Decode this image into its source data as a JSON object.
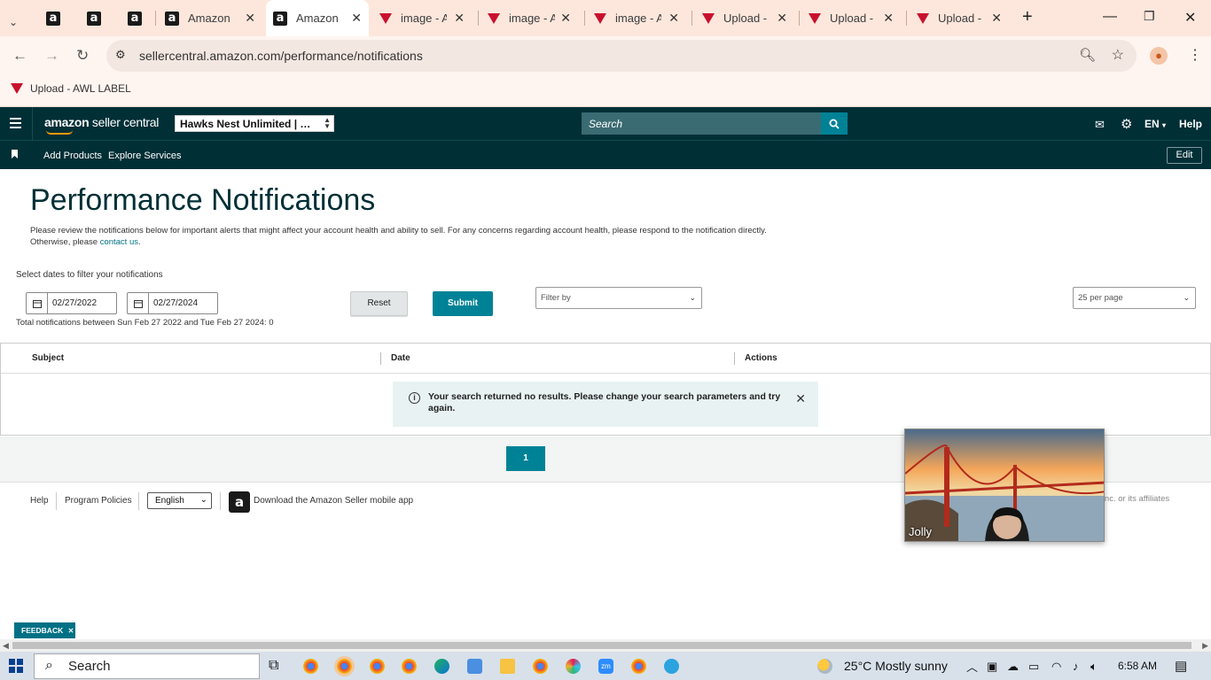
{
  "browser": {
    "tabs": [
      {
        "title": "",
        "icon": "amazon-favicon"
      },
      {
        "title": "",
        "icon": "amazon-favicon"
      },
      {
        "title": "",
        "icon": "amazon-favicon"
      },
      {
        "title": "Amazon",
        "icon": "amazon-favicon"
      },
      {
        "title": "Amazon",
        "icon": "amazon-favicon",
        "active": true
      },
      {
        "title": "image - A",
        "icon": "awl-favicon"
      },
      {
        "title": "image - A",
        "icon": "awl-favicon"
      },
      {
        "title": "image - A",
        "icon": "awl-favicon"
      },
      {
        "title": "Upload -",
        "icon": "awl-favicon"
      },
      {
        "title": "Upload -",
        "icon": "awl-favicon"
      },
      {
        "title": "Upload -",
        "icon": "awl-favicon"
      }
    ],
    "url": "sellercentral.amazon.com/performance/notifications",
    "bookmark": "Upload - AWL LABEL"
  },
  "header": {
    "logo_main": "amazon",
    "logo_sub": " seller central",
    "account": "Hawks Nest Unlimited | Unit...",
    "search_placeholder": "Search",
    "language": "EN",
    "help": "Help",
    "nav": [
      "Add Products",
      "Explore Services"
    ],
    "edit": "Edit"
  },
  "page": {
    "title": "Performance Notifications",
    "description": "Please review the notifications below for important alerts that might affect your account health and ability to sell. For any concerns regarding account health, please respond to the notification directly.",
    "description2": "Otherwise, please ",
    "contact_link": "contact us",
    "description_end": ".",
    "filter_label": "Select dates to filter your notifications",
    "date_from": "02/27/2022",
    "date_to": "02/27/2024",
    "reset": "Reset",
    "submit": "Submit",
    "filter_by": "Filter by",
    "per_page": "25 per page",
    "total": "Total notifications between Sun Feb 27 2022 and Tue Feb 27 2024: 0",
    "columns": [
      "Subject",
      "Date",
      "Actions"
    ],
    "no_results": "Your search returned no results. Please change your search parameters and try again.",
    "current_page": "1"
  },
  "footer": {
    "help": "Help",
    "policies": "Program Policies",
    "language": "English",
    "app": "Download the Amazon Seller mobile app",
    "copyright": ", Inc. or its affiliates"
  },
  "video": {
    "name": "Jolly"
  },
  "feedback": "FEEDBACK",
  "taskbar": {
    "search": "Search",
    "weather": "25°C  Mostly sunny",
    "time": "6:58 AM"
  }
}
